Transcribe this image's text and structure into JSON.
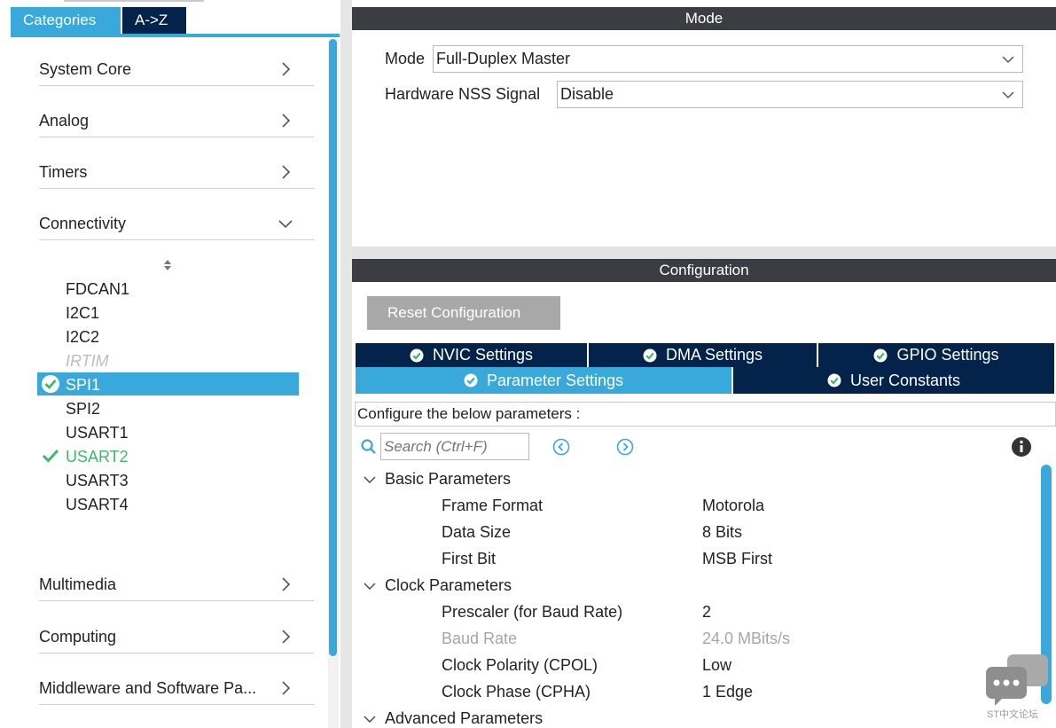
{
  "sidebar": {
    "tabs": [
      {
        "label": "Categories"
      },
      {
        "label": "A->Z"
      }
    ],
    "categories": [
      {
        "label": "System Core"
      },
      {
        "label": "Analog"
      },
      {
        "label": "Timers"
      },
      {
        "label": "Connectivity"
      },
      {
        "label": "Multimedia"
      },
      {
        "label": "Computing"
      },
      {
        "label": "Middleware and Software Pa..."
      }
    ],
    "connectivity_items": [
      {
        "label": "FDCAN1"
      },
      {
        "label": "I2C1"
      },
      {
        "label": "I2C2"
      },
      {
        "label": "IRTIM"
      },
      {
        "label": "SPI1"
      },
      {
        "label": "SPI2"
      },
      {
        "label": "USART1"
      },
      {
        "label": "USART2"
      },
      {
        "label": "USART3"
      },
      {
        "label": "USART4"
      }
    ]
  },
  "mode_panel": {
    "title": "Mode",
    "mode_label": "Mode",
    "mode_value": "Full-Duplex Master",
    "nss_label": "Hardware NSS Signal",
    "nss_value": "Disable"
  },
  "config_panel": {
    "title": "Configuration",
    "reset_label": "Reset Configuration",
    "tabs_row1": [
      {
        "label": "NVIC Settings"
      },
      {
        "label": "DMA Settings"
      },
      {
        "label": "GPIO Settings"
      }
    ],
    "tabs_row2": [
      {
        "label": "Parameter Settings"
      },
      {
        "label": "User Constants"
      }
    ],
    "instruction": "Configure the below parameters :",
    "search_placeholder": "Search (Ctrl+F)",
    "groups": [
      {
        "title": "Basic Parameters",
        "params": [
          {
            "name": "Frame Format",
            "value": "Motorola"
          },
          {
            "name": "Data Size",
            "value": "8 Bits"
          },
          {
            "name": "First Bit",
            "value": "MSB First"
          }
        ]
      },
      {
        "title": "Clock Parameters",
        "params": [
          {
            "name": "Prescaler (for Baud Rate)",
            "value": "2"
          },
          {
            "name": "Baud Rate",
            "value": "24.0 MBits/s"
          },
          {
            "name": "Clock Polarity (CPOL)",
            "value": "Low"
          },
          {
            "name": "Clock Phase (CPHA)",
            "value": "1 Edge"
          }
        ]
      },
      {
        "title": "Advanced Parameters"
      }
    ]
  },
  "watermark": {
    "text": "ST中文论坛"
  },
  "colors": {
    "accent": "#39a9db",
    "dark_navy": "#03234b",
    "header_gray": "#3a3d42",
    "ok_green": "#3db86e"
  }
}
